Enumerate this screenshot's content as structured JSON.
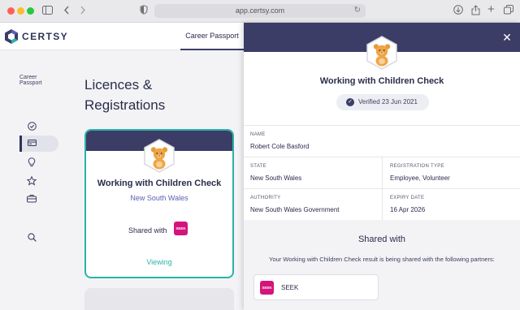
{
  "browser": {
    "url": "app.certsy.com",
    "icons": [
      "sidebar-toggle-icon",
      "back-icon",
      "forward-icon",
      "shield-icon",
      "reload-icon",
      "download-icon",
      "share-icon",
      "new-tab-icon",
      "tabs-overview-icon"
    ]
  },
  "header": {
    "brand": "CERTSY",
    "tab": "Career Passport"
  },
  "sidebar": {
    "title": "Career Passport",
    "info_glyph": "i",
    "items": [
      {
        "icon": "check-circle-icon",
        "glyph": "✓",
        "active": false
      },
      {
        "icon": "id-card-icon",
        "glyph": "▭",
        "active": true
      },
      {
        "icon": "lightbulb-icon",
        "glyph": "♁",
        "active": false
      },
      {
        "icon": "star-icon",
        "glyph": "☆",
        "active": false
      },
      {
        "icon": "briefcase-icon",
        "glyph": "⌂",
        "active": false
      },
      {
        "icon": "search-icon",
        "glyph": "⚲",
        "active": false
      }
    ]
  },
  "main": {
    "title": "Licences & Registrations",
    "card": {
      "title": "Working with Children Check",
      "state": "New South Wales",
      "shared_label": "Shared with",
      "status": "Viewing"
    }
  },
  "panel": {
    "title": "Working with Children Check",
    "verified": "Verified 23 Jun 2021",
    "fields": {
      "name_label": "NAME",
      "name_value": "Robert Cole Basford",
      "state_label": "STATE",
      "state_value": "New South Wales",
      "regtype_label": "REGISTRATION TYPE",
      "regtype_value": "Employee, Volunteer",
      "authority_label": "AUTHORITY",
      "authority_value": "New South Wales Government",
      "expiry_label": "EXPIRY DATE",
      "expiry_value": "16 Apr 2026"
    },
    "shared": {
      "title": "Shared with",
      "description": "Your Working with Children Check result is being shared with the following partners:",
      "partner": "SEEK",
      "partner_logo_text": "SEEK"
    }
  },
  "colors": {
    "navy": "#3b3d67",
    "teal": "#2bb3a8",
    "seek_pink": "#d4137d",
    "page_bg": "#f3f3f6"
  }
}
